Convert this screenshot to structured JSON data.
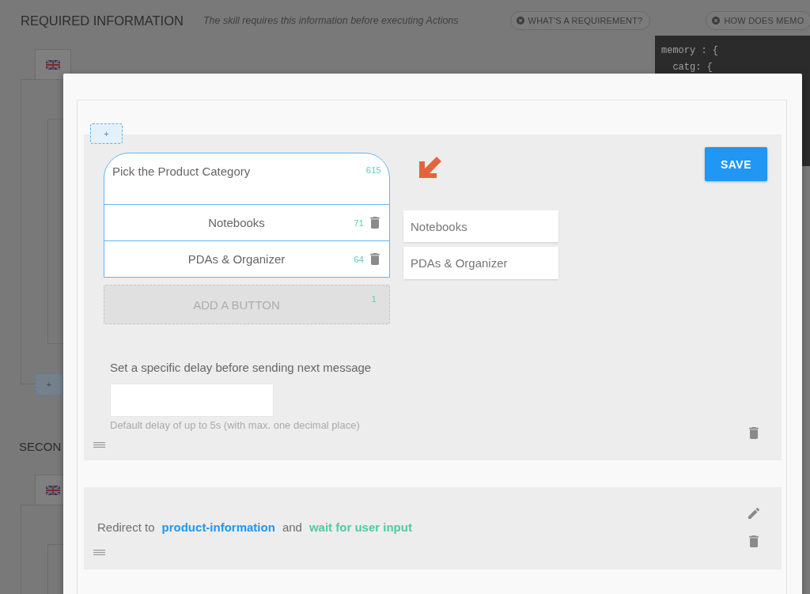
{
  "background": {
    "sections": [
      {
        "title": "REQUIRED INFORMATION",
        "subtitle": "The skill requires this information before executing Actions",
        "help_chips": [
          "WHAT'S A REQUIREMENT?",
          "HOW DOES MEMO"
        ],
        "add_label": "+"
      },
      {
        "title": "SECON"
      }
    ],
    "code_lines": [
      "memory : {",
      "  catg: {"
    ]
  },
  "dialog": {
    "add_step_label": "+",
    "message_step": {
      "text": "Pick the Product Category",
      "count": "615",
      "buttons": [
        {
          "label": "Notebooks",
          "count": "71",
          "value": "Notebooks"
        },
        {
          "label": "PDAs & Organizer",
          "count": "64",
          "value": "PDAs & Organizer"
        }
      ],
      "add_button": {
        "label": "ADD A BUTTON",
        "count": "1"
      },
      "save_label": "SAVE",
      "delay_label": "Set a specific delay before sending next message",
      "delay_hint": "Default delay of up to 5s (with max. one decimal place)"
    },
    "redirect_step": {
      "prefix": "Redirect to",
      "target": "product-information",
      "joiner": "and",
      "mode": "wait for user input"
    }
  }
}
